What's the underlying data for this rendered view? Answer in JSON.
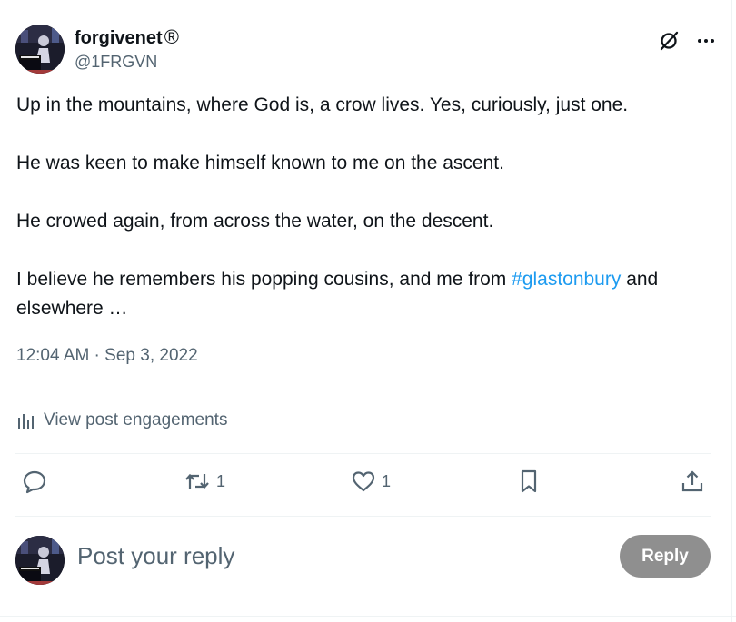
{
  "author": {
    "display_name": "forgivenet",
    "verified_mark": "®",
    "handle": "@1FRGVN",
    "avatar_icon": "profile-photo-pianist-icon"
  },
  "header_actions": {
    "grok_icon": "grok-icon",
    "more_icon": "more-dots-icon"
  },
  "post": {
    "paragraphs": [
      "Up in the mountains, where God is, a crow lives. Yes, curiously, just one.",
      "He was keen to make himself known to me on the ascent.",
      "He crowed again, from across the water, on the descent."
    ],
    "last_paragraph_before": "I believe he remembers his popping cousins, and me from ",
    "hashtag": "#glastonbury",
    "last_paragraph_after": " and elsewhere …",
    "time": "12:04 AM",
    "separator": " · ",
    "date": "Sep 3, 2022"
  },
  "engagements": {
    "label": "View post engagements",
    "icon": "analytics-bars-icon"
  },
  "actions": {
    "reply_count": "",
    "repost_count": "1",
    "like_count": "1"
  },
  "compose": {
    "placeholder": "Post your reply",
    "button_label": "Reply"
  },
  "colors": {
    "text": "#0f1419",
    "secondary": "#536471",
    "link": "#1d9bf0",
    "divider": "#eff3f4",
    "reply_button_disabled": "#8f8f8f"
  }
}
